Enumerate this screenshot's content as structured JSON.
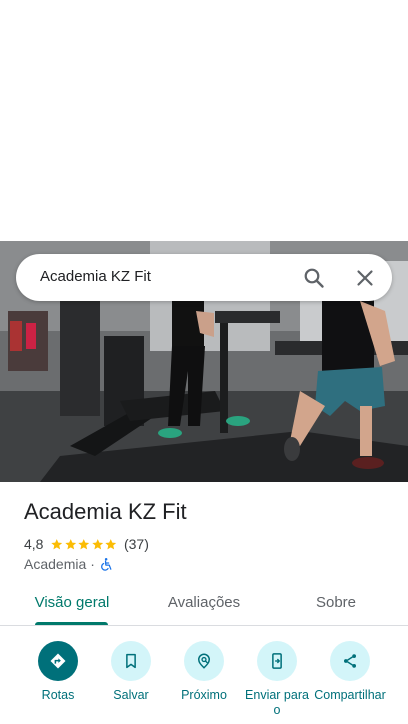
{
  "search": {
    "query": "Academia KZ Fit"
  },
  "place": {
    "name": "Academia KZ Fit",
    "rating": "4,8",
    "rating_stars": 5,
    "review_count": "(37)",
    "category": "Academia",
    "separator": "·"
  },
  "tabs": [
    {
      "label": "Visão geral",
      "active": true
    },
    {
      "label": "Avaliações",
      "active": false
    },
    {
      "label": "Sobre",
      "active": false
    }
  ],
  "actions": [
    {
      "label": "Rotas",
      "icon": "directions-icon"
    },
    {
      "label": "Salvar",
      "icon": "bookmark-icon"
    },
    {
      "label": "Próximo",
      "icon": "nearby-icon"
    },
    {
      "label": "Enviar para o",
      "icon": "send-to-phone-icon"
    },
    {
      "label": "Compartilhar",
      "icon": "share-icon"
    }
  ],
  "colors": {
    "accent": "#00796b",
    "action_primary": "#00707a",
    "action_secondary_bg": "#d3f5f9",
    "star": "#fbbc04",
    "accessibility_icon": "#1a73e8"
  }
}
